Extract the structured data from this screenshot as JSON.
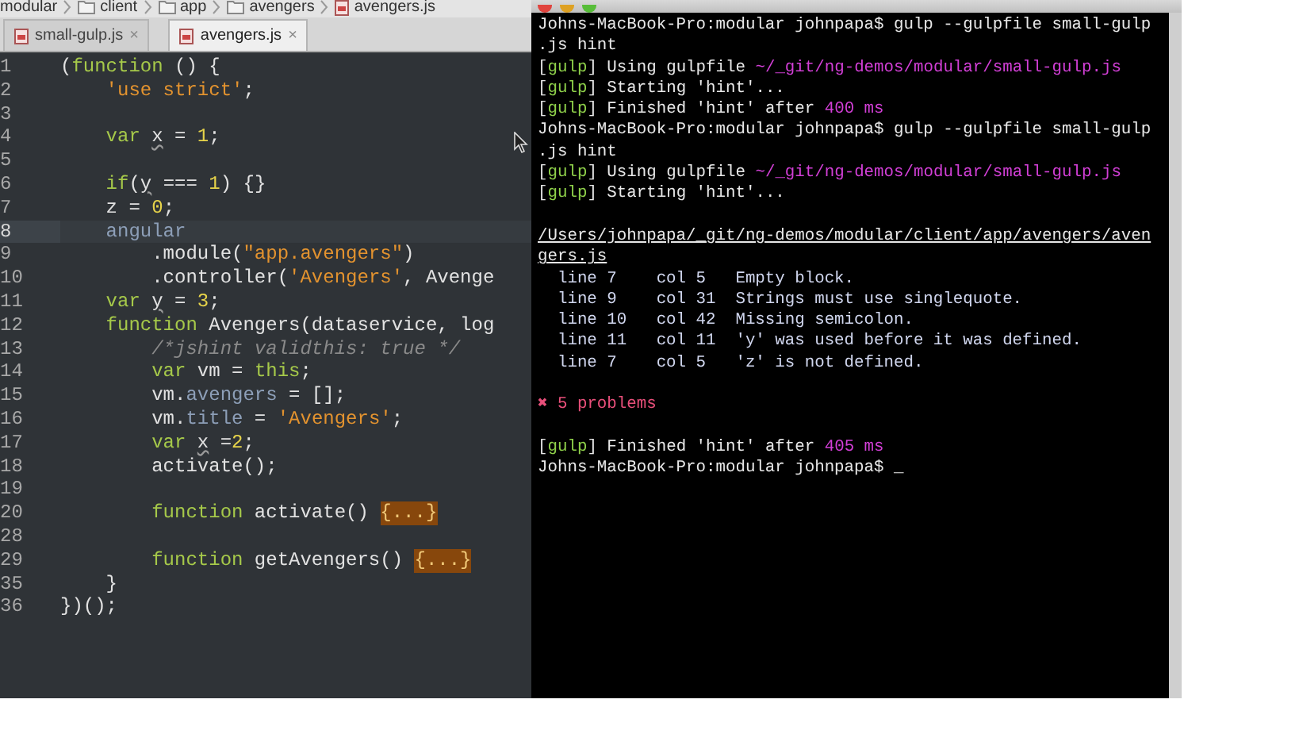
{
  "breadcrumb": [
    {
      "label": "modular",
      "kind": "folder-root"
    },
    {
      "label": "client",
      "kind": "folder"
    },
    {
      "label": "app",
      "kind": "folder"
    },
    {
      "label": "avengers",
      "kind": "folder"
    },
    {
      "label": "avengers.js",
      "kind": "file"
    }
  ],
  "tabs": [
    {
      "label": "small-gulp.js",
      "selected": false,
      "close": "×"
    },
    {
      "label": "avengers.js",
      "selected": true,
      "close": "×"
    }
  ],
  "editor_lines": [
    {
      "number": "1",
      "current": false,
      "tokens": [
        {
          "text": "(",
          "kind": "plain"
        },
        {
          "text": "function",
          "kind": "keyword"
        },
        {
          "text": " () {",
          "kind": "plain"
        }
      ]
    },
    {
      "number": "2",
      "current": false,
      "tokens": [
        {
          "text": "    'use strict'",
          "kind": "string"
        },
        {
          "text": ";",
          "kind": "plain"
        }
      ]
    },
    {
      "number": "3",
      "current": false
    },
    {
      "number": "4",
      "current": false,
      "tokens": [
        {
          "text": "    var ",
          "kind": "keyword"
        },
        {
          "text": "x",
          "kind": "warn"
        },
        {
          "text": " = ",
          "kind": "plain"
        },
        {
          "text": "1",
          "kind": "number"
        },
        {
          "text": ";",
          "kind": "plain"
        }
      ]
    },
    {
      "number": "5",
      "current": false
    },
    {
      "number": "6",
      "current": false,
      "tokens": [
        {
          "text": "    if",
          "kind": "keyword"
        },
        {
          "text": "(",
          "kind": "plain"
        },
        {
          "text": "y",
          "kind": "warn"
        },
        {
          "text": " === ",
          "kind": "plain"
        },
        {
          "text": "1",
          "kind": "number"
        },
        {
          "text": ") {}",
          "kind": "plain"
        }
      ]
    },
    {
      "number": "7",
      "current": false,
      "tokens": [
        {
          "text": "    z = ",
          "kind": "plain"
        },
        {
          "text": "0",
          "kind": "number"
        },
        {
          "text": ";",
          "kind": "plain"
        }
      ]
    },
    {
      "number": "8",
      "current": true,
      "tokens": [
        {
          "text": "    angular",
          "kind": "ident"
        }
      ]
    },
    {
      "number": "9",
      "current": false,
      "tokens": [
        {
          "text": "        .module(",
          "kind": "plain"
        },
        {
          "text": "\"app.avengers\"",
          "kind": "string"
        },
        {
          "text": ")",
          "kind": "plain"
        }
      ]
    },
    {
      "number": "10",
      "current": false,
      "tokens": [
        {
          "text": "        .controller(",
          "kind": "plain"
        },
        {
          "text": "'Avengers'",
          "kind": "string"
        },
        {
          "text": ", Avenge",
          "kind": "plain"
        }
      ]
    },
    {
      "number": "11",
      "current": false,
      "tokens": [
        {
          "text": "    var ",
          "kind": "keyword"
        },
        {
          "text": "y",
          "kind": "warn"
        },
        {
          "text": " = ",
          "kind": "plain"
        },
        {
          "text": "3",
          "kind": "number"
        },
        {
          "text": ";",
          "kind": "plain"
        }
      ]
    },
    {
      "number": "12",
      "current": false,
      "tokens": [
        {
          "text": "    function",
          "kind": "keyword"
        },
        {
          "text": " Avengers(dataservice, log",
          "kind": "plain"
        }
      ]
    },
    {
      "number": "13",
      "current": false,
      "tokens": [
        {
          "text": "        /*jshint validthis: true */",
          "kind": "comment"
        }
      ]
    },
    {
      "number": "14",
      "current": false,
      "tokens": [
        {
          "text": "        var",
          "kind": "keyword"
        },
        {
          "text": " vm = ",
          "kind": "plain"
        },
        {
          "text": "this",
          "kind": "keyword"
        },
        {
          "text": ";",
          "kind": "plain"
        }
      ]
    },
    {
      "number": "15",
      "current": false,
      "tokens": [
        {
          "text": "        vm.",
          "kind": "plain"
        },
        {
          "text": "avengers",
          "kind": "property"
        },
        {
          "text": " = [];",
          "kind": "plain"
        }
      ]
    },
    {
      "number": "16",
      "current": false,
      "tokens": [
        {
          "text": "        vm.",
          "kind": "plain"
        },
        {
          "text": "title",
          "kind": "property"
        },
        {
          "text": " = ",
          "kind": "plain"
        },
        {
          "text": "'Avengers'",
          "kind": "string"
        },
        {
          "text": ";",
          "kind": "plain"
        }
      ]
    },
    {
      "number": "17",
      "current": false,
      "tokens": [
        {
          "text": "        var ",
          "kind": "keyword"
        },
        {
          "text": "x",
          "kind": "warn"
        },
        {
          "text": " =",
          "kind": "plain"
        },
        {
          "text": "2",
          "kind": "number"
        },
        {
          "text": ";",
          "kind": "plain"
        }
      ]
    },
    {
      "number": "18",
      "current": false,
      "tokens": [
        {
          "text": "        activate();",
          "kind": "plain"
        }
      ]
    },
    {
      "number": "19",
      "current": false
    },
    {
      "number": "20",
      "current": false,
      "tokens": [
        {
          "text": "        function",
          "kind": "keyword"
        },
        {
          "text": " activate() ",
          "kind": "plain"
        }
      ],
      "fold": "{...}"
    },
    {
      "number": "28",
      "current": false
    },
    {
      "number": "29",
      "current": false,
      "tokens": [
        {
          "text": "        function",
          "kind": "keyword"
        },
        {
          "text": " getAvengers() ",
          "kind": "plain"
        }
      ],
      "fold": "{...}"
    },
    {
      "number": "35",
      "current": false,
      "tokens": [
        {
          "text": "    }",
          "kind": "plain"
        }
      ]
    },
    {
      "number": "36",
      "current": false,
      "tokens": [
        {
          "text": "})();",
          "kind": "plain"
        }
      ]
    }
  ],
  "terminal_lines": [
    {
      "segments": [
        {
          "text": "Johns-MacBook-Pro:modular johnpapa$ gulp --gulpfile small-gulp",
          "kind": "plain"
        }
      ]
    },
    {
      "segments": [
        {
          "text": ".js hint",
          "kind": "plain"
        }
      ]
    },
    {
      "segments": [
        {
          "text": "[",
          "kind": "plain"
        },
        {
          "text": "gulp",
          "kind": "gulp"
        },
        {
          "text": "] Using gulpfile ",
          "kind": "plain"
        },
        {
          "text": "~/_git/ng-demos/modular/small-gulp.js",
          "kind": "magenta"
        }
      ]
    },
    {
      "segments": [
        {
          "text": "[",
          "kind": "plain"
        },
        {
          "text": "gulp",
          "kind": "gulp"
        },
        {
          "text": "] Starting 'hint'...",
          "kind": "plain"
        }
      ]
    },
    {
      "segments": [
        {
          "text": "[",
          "kind": "plain"
        },
        {
          "text": "gulp",
          "kind": "gulp"
        },
        {
          "text": "] Finished 'hint' after ",
          "kind": "plain"
        },
        {
          "text": "400 ms",
          "kind": "magenta"
        }
      ]
    },
    {
      "segments": [
        {
          "text": "Johns-MacBook-Pro:modular johnpapa$ gulp --gulpfile small-gulp",
          "kind": "plain"
        }
      ]
    },
    {
      "segments": [
        {
          "text": ".js hint",
          "kind": "plain"
        }
      ]
    },
    {
      "segments": [
        {
          "text": "[",
          "kind": "plain"
        },
        {
          "text": "gulp",
          "kind": "gulp"
        },
        {
          "text": "] Using gulpfile ",
          "kind": "plain"
        },
        {
          "text": "~/_git/ng-demos/modular/small-gulp.js",
          "kind": "magenta"
        }
      ]
    },
    {
      "segments": [
        {
          "text": "[",
          "kind": "plain"
        },
        {
          "text": "gulp",
          "kind": "gulp"
        },
        {
          "text": "] Starting 'hint'...",
          "kind": "plain"
        }
      ]
    },
    {
      "space_before": true,
      "segments": [
        {
          "text": "/Users/johnpapa/_git/ng-demos/modular/client/app/avengers/aven",
          "kind": "underline"
        }
      ]
    },
    {
      "segments": [
        {
          "text": "gers.js",
          "kind": "underline"
        }
      ]
    },
    {
      "segments": [
        {
          "text": "  line 7    col 5   Empty block.",
          "kind": "report"
        }
      ]
    },
    {
      "segments": [
        {
          "text": "  line 9    col 31  Strings must use singlequote.",
          "kind": "report"
        }
      ]
    },
    {
      "segments": [
        {
          "text": "  line 10   col 42  Missing semicolon.",
          "kind": "report"
        }
      ]
    },
    {
      "segments": [
        {
          "text": "  line 11   col 11  'y' was used before it was defined.",
          "kind": "report"
        }
      ]
    },
    {
      "segments": [
        {
          "text": "  line 7    col 5   'z' is not defined.",
          "kind": "report"
        }
      ]
    },
    {
      "space_before": true,
      "segments": [
        {
          "text": "✖ 5 problems",
          "kind": "error"
        }
      ]
    },
    {
      "space_before": true,
      "segments": [
        {
          "text": "[",
          "kind": "plain"
        },
        {
          "text": "gulp",
          "kind": "gulp"
        },
        {
          "text": "] Finished 'hint' after ",
          "kind": "plain"
        },
        {
          "text": "405 ms",
          "kind": "magenta"
        }
      ]
    },
    {
      "segments": [
        {
          "text": "Johns-MacBook-Pro:modular johnpapa$ _",
          "kind": "plain"
        }
      ]
    }
  ]
}
